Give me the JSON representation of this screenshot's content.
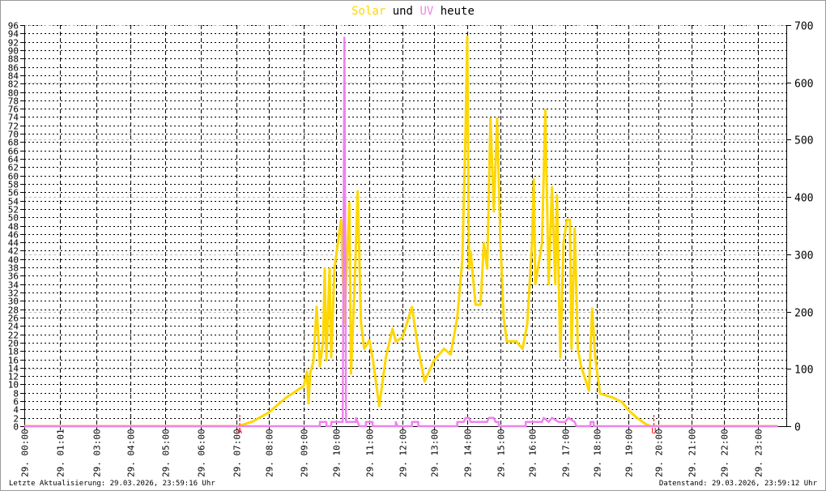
{
  "title": {
    "part1": "Solar",
    "part2": "und",
    "part3": "UV",
    "part4": "heute"
  },
  "footer": {
    "left": "Letzte Aktualisierung: 29.03.2026, 23:59:16 Uhr",
    "right": "Datenstand: 29.03.2026, 23:59:12 Uhr"
  },
  "colors": {
    "solar": "#FFD700",
    "uv": "#EE82EE",
    "marker": "#FF0000"
  },
  "chart_data": {
    "type": "line",
    "title": "Solar und UV heute",
    "x_ticks": [
      {
        "h": 0,
        "label": "29. 00:00"
      },
      {
        "h": 1.017,
        "label": "29. 01:01"
      },
      {
        "h": 3,
        "label": "29. 03:00"
      },
      {
        "h": 4,
        "label": "29. 04:00"
      },
      {
        "h": 5,
        "label": "29. 05:00"
      },
      {
        "h": 6,
        "label": "29. 06:00"
      },
      {
        "h": 7,
        "label": "29. 07:00"
      },
      {
        "h": 8,
        "label": "29. 08:00"
      },
      {
        "h": 9,
        "label": "29. 09:00"
      },
      {
        "h": 10,
        "label": "29. 10:00"
      },
      {
        "h": 11,
        "label": "29. 11:00"
      },
      {
        "h": 12,
        "label": "29. 12:00"
      },
      {
        "h": 13,
        "label": "29. 13:00"
      },
      {
        "h": 14,
        "label": "29. 14:00"
      },
      {
        "h": 15,
        "label": "29. 15:00"
      },
      {
        "h": 16,
        "label": "29. 16:00"
      },
      {
        "h": 17,
        "label": "29. 17:00"
      },
      {
        "h": 18,
        "label": "29. 18:00"
      },
      {
        "h": 19,
        "label": "29. 19:00"
      },
      {
        "h": 20,
        "label": "29. 20:00"
      },
      {
        "h": 21,
        "label": "29. 21:00"
      },
      {
        "h": 22,
        "label": "29. 22:00"
      },
      {
        "h": 23,
        "label": "29. 23:00"
      }
    ],
    "left_axis": {
      "min": 0,
      "max": 96,
      "step": 2
    },
    "right_axis": {
      "min": 0,
      "max": 700,
      "step": 100
    },
    "markers": [
      {
        "h": 7.1,
        "label": "A"
      },
      {
        "h": 19.85,
        "label": "U"
      }
    ],
    "series": [
      {
        "name": "Solar",
        "axis": "right",
        "points": [
          [
            0,
            0
          ],
          [
            7.05,
            0
          ],
          [
            7.5,
            8
          ],
          [
            8,
            24
          ],
          [
            8.5,
            50
          ],
          [
            9,
            70
          ],
          [
            9.1,
            95
          ],
          [
            9.15,
            40
          ],
          [
            9.2,
            92
          ],
          [
            9.3,
            113
          ],
          [
            9.4,
            208
          ],
          [
            9.5,
            105
          ],
          [
            9.6,
            148
          ],
          [
            9.65,
            275
          ],
          [
            9.7,
            115
          ],
          [
            9.8,
            275
          ],
          [
            9.85,
            120
          ],
          [
            9.95,
            275
          ],
          [
            10.1,
            340
          ],
          [
            10.15,
            360
          ],
          [
            10.25,
            180
          ],
          [
            10.3,
            250
          ],
          [
            10.4,
            390
          ],
          [
            10.45,
            92
          ],
          [
            10.55,
            235
          ],
          [
            10.65,
            410
          ],
          [
            10.75,
            180
          ],
          [
            10.85,
            135
          ],
          [
            11.0,
            150
          ],
          [
            11.1,
            120
          ],
          [
            11.3,
            35
          ],
          [
            11.5,
            120
          ],
          [
            11.7,
            170
          ],
          [
            11.8,
            148
          ],
          [
            12.0,
            155
          ],
          [
            12.3,
            208
          ],
          [
            12.5,
            135
          ],
          [
            12.7,
            78
          ],
          [
            13.0,
            115
          ],
          [
            13.3,
            135
          ],
          [
            13.5,
            125
          ],
          [
            13.7,
            190
          ],
          [
            13.85,
            290
          ],
          [
            13.95,
            516
          ],
          [
            14.0,
            680
          ],
          [
            14.05,
            275
          ],
          [
            14.1,
            305
          ],
          [
            14.25,
            212
          ],
          [
            14.4,
            212
          ],
          [
            14.5,
            320
          ],
          [
            14.6,
            275
          ],
          [
            14.7,
            537
          ],
          [
            14.8,
            375
          ],
          [
            14.9,
            537
          ],
          [
            15.0,
            320
          ],
          [
            15.1,
            190
          ],
          [
            15.2,
            148
          ],
          [
            15.5,
            148
          ],
          [
            15.7,
            135
          ],
          [
            15.85,
            178
          ],
          [
            16.0,
            320
          ],
          [
            16.05,
            431
          ],
          [
            16.1,
            248
          ],
          [
            16.3,
            320
          ],
          [
            16.4,
            552
          ],
          [
            16.5,
            248
          ],
          [
            16.6,
            417
          ],
          [
            16.7,
            248
          ],
          [
            16.75,
            403
          ],
          [
            16.85,
            120
          ],
          [
            16.95,
            320
          ],
          [
            17.05,
            360
          ],
          [
            17.15,
            360
          ],
          [
            17.2,
            135
          ],
          [
            17.3,
            345
          ],
          [
            17.4,
            135
          ],
          [
            17.5,
            105
          ],
          [
            17.75,
            62
          ],
          [
            17.85,
            205
          ],
          [
            17.95,
            120
          ],
          [
            18.1,
            57
          ],
          [
            18.5,
            50
          ],
          [
            18.8,
            42
          ],
          [
            19.0,
            28
          ],
          [
            19.3,
            14
          ],
          [
            19.6,
            3
          ],
          [
            19.75,
            0
          ],
          [
            23.6,
            0
          ]
        ]
      },
      {
        "name": "UV",
        "axis": "left",
        "points": [
          [
            0,
            0
          ],
          [
            9.5,
            0
          ],
          [
            9.5,
            1
          ],
          [
            9.7,
            1
          ],
          [
            9.7,
            0
          ],
          [
            9.85,
            0
          ],
          [
            9.85,
            1
          ],
          [
            10.2,
            1
          ],
          [
            10.25,
            93
          ],
          [
            10.3,
            1
          ],
          [
            10.6,
            1
          ],
          [
            10.6,
            2
          ],
          [
            10.7,
            0
          ],
          [
            10.9,
            0
          ],
          [
            10.9,
            1
          ],
          [
            11.1,
            1
          ],
          [
            11.1,
            0
          ],
          [
            11.8,
            0
          ],
          [
            11.8,
            1
          ],
          [
            11.85,
            0
          ],
          [
            12.3,
            0
          ],
          [
            12.3,
            1
          ],
          [
            12.5,
            1
          ],
          [
            12.5,
            0
          ],
          [
            13.7,
            0
          ],
          [
            13.7,
            1
          ],
          [
            13.9,
            1
          ],
          [
            13.95,
            2
          ],
          [
            14.05,
            2
          ],
          [
            14.1,
            1
          ],
          [
            14.6,
            1
          ],
          [
            14.65,
            2
          ],
          [
            14.8,
            2
          ],
          [
            14.85,
            1
          ],
          [
            14.95,
            1
          ],
          [
            14.95,
            0
          ],
          [
            15.8,
            0
          ],
          [
            15.8,
            1
          ],
          [
            16.3,
            1
          ],
          [
            16.35,
            2
          ],
          [
            16.5,
            1
          ],
          [
            16.6,
            2
          ],
          [
            16.8,
            1
          ],
          [
            17.0,
            1
          ],
          [
            17.1,
            2
          ],
          [
            17.3,
            1
          ],
          [
            17.35,
            0
          ],
          [
            17.8,
            0
          ],
          [
            17.8,
            1
          ],
          [
            17.9,
            1
          ],
          [
            17.9,
            0
          ],
          [
            23.6,
            0
          ]
        ]
      }
    ]
  }
}
